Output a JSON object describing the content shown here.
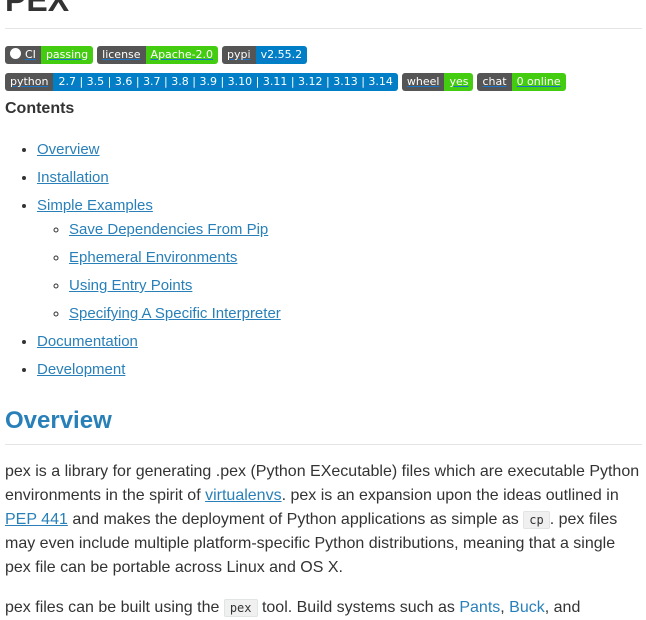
{
  "title": "PEX",
  "badges_row1": [
    {
      "left": "CI",
      "right": "passing",
      "icon": "github-icon",
      "color": "#4c1"
    },
    {
      "left": "license",
      "right": "Apache-2.0",
      "color": "#4c1"
    },
    {
      "left": "pypi",
      "right": "v2.55.2",
      "color": "#007ec6"
    }
  ],
  "badges_row2": [
    {
      "left": "python",
      "right": "2.7 | 3.5 | 3.6 | 3.7 | 3.8 | 3.9 | 3.10 | 3.11 | 3.12 | 3.13 | 3.14",
      "color": "#007ec6"
    },
    {
      "left": "wheel",
      "right": "yes",
      "color": "#4c1"
    },
    {
      "left": "chat",
      "right": "0 online",
      "color": "#4c1"
    }
  ],
  "contents": {
    "heading": "Contents",
    "items": [
      {
        "label": "Overview"
      },
      {
        "label": "Installation"
      },
      {
        "label": "Simple Examples",
        "children": [
          {
            "label": "Save Dependencies From Pip"
          },
          {
            "label": "Ephemeral Environments"
          },
          {
            "label": "Using Entry Points"
          },
          {
            "label": "Specifying A Specific Interpreter"
          }
        ]
      },
      {
        "label": "Documentation"
      },
      {
        "label": "Development"
      }
    ]
  },
  "overview": {
    "heading": "Overview",
    "p1": {
      "t1": "pex is a library for generating .pex (Python EXecutable) files which are executable Python environments in the spirit of ",
      "link1": "virtualenvs",
      "t2": ". pex is an expansion upon the ideas outlined in ",
      "link2": "PEP 441",
      "t3": " and makes the deployment of Python applications as simple as ",
      "code1": "cp",
      "t4": ". pex files may even include multiple platform-specific Python distributions, meaning that a single pex file can be portable across Linux and OS X."
    },
    "p2": {
      "t1": "pex files can be built using the ",
      "code1": "pex",
      "t2": " tool. Build systems such as ",
      "link1": "Pants",
      "t3": ", ",
      "link2": "Buck",
      "t4": ", and"
    }
  }
}
